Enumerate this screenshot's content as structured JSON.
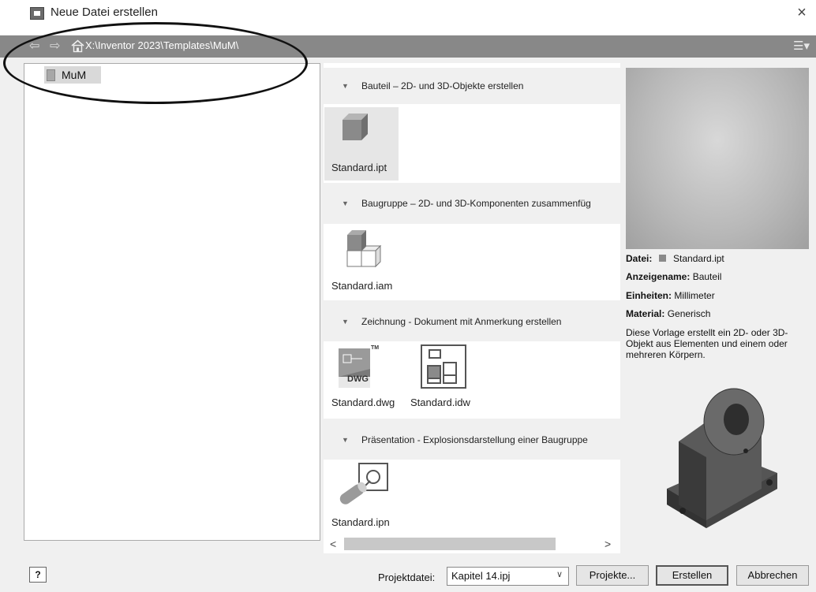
{
  "window": {
    "title": "Neue Datei erstellen",
    "close_glyph": "×"
  },
  "pathbar": {
    "back_icon": "arrow-left",
    "forward_icon": "arrow-right",
    "home_icon": "home",
    "path": "X:\\Inventor 2023\\Templates\\MuM\\",
    "view_icon": "list-view"
  },
  "tree": {
    "items": [
      {
        "label": "MuM",
        "icon": "folder"
      }
    ]
  },
  "categories": [
    {
      "title": "Bauteil – 2D- und 3D-Objekte erstellen",
      "templates": [
        {
          "label": "Standard.ipt",
          "icon": "part-cube"
        }
      ]
    },
    {
      "title": "Baugruppe – 2D- und 3D-Komponenten zusammenfüg",
      "templates": [
        {
          "label": "Standard.iam",
          "icon": "assembly-blocks"
        }
      ]
    },
    {
      "title": "Zeichnung - Dokument mit Anmerkung erstellen",
      "templates": [
        {
          "label": "Standard.dwg",
          "icon": "dwg-drawing",
          "badge": "DWG",
          "tm": "TM"
        },
        {
          "label": "Standard.idw",
          "icon": "idw-drawing"
        }
      ]
    },
    {
      "title": "Präsentation - Explosionsdarstellung einer Baugruppe",
      "templates": [
        {
          "label": "Standard.ipn",
          "icon": "presentation"
        }
      ]
    }
  ],
  "preview": {
    "datei_key": "Datei:",
    "datei_value": "Standard.ipt",
    "anzeigename_key": "Anzeigename:",
    "anzeigename_value": "Bauteil",
    "einheiten_key": "Einheiten:",
    "einheiten_value": "Millimeter",
    "material_key": "Material:",
    "material_value": "Generisch",
    "description": "Diese Vorlage erstellt ein 2D- oder 3D-Objekt aus Elementen und einem oder mehreren Körpern."
  },
  "footer": {
    "help_label": "?",
    "projektdatei_label": "Projektdatei:",
    "projektdatei_value": "Kapitel 14.ipj",
    "projekte_button": "Projekte...",
    "erstellen_button": "Erstellen",
    "abbrechen_button": "Abbrechen"
  },
  "scrollbar": {
    "left": "<",
    "right": ">"
  }
}
